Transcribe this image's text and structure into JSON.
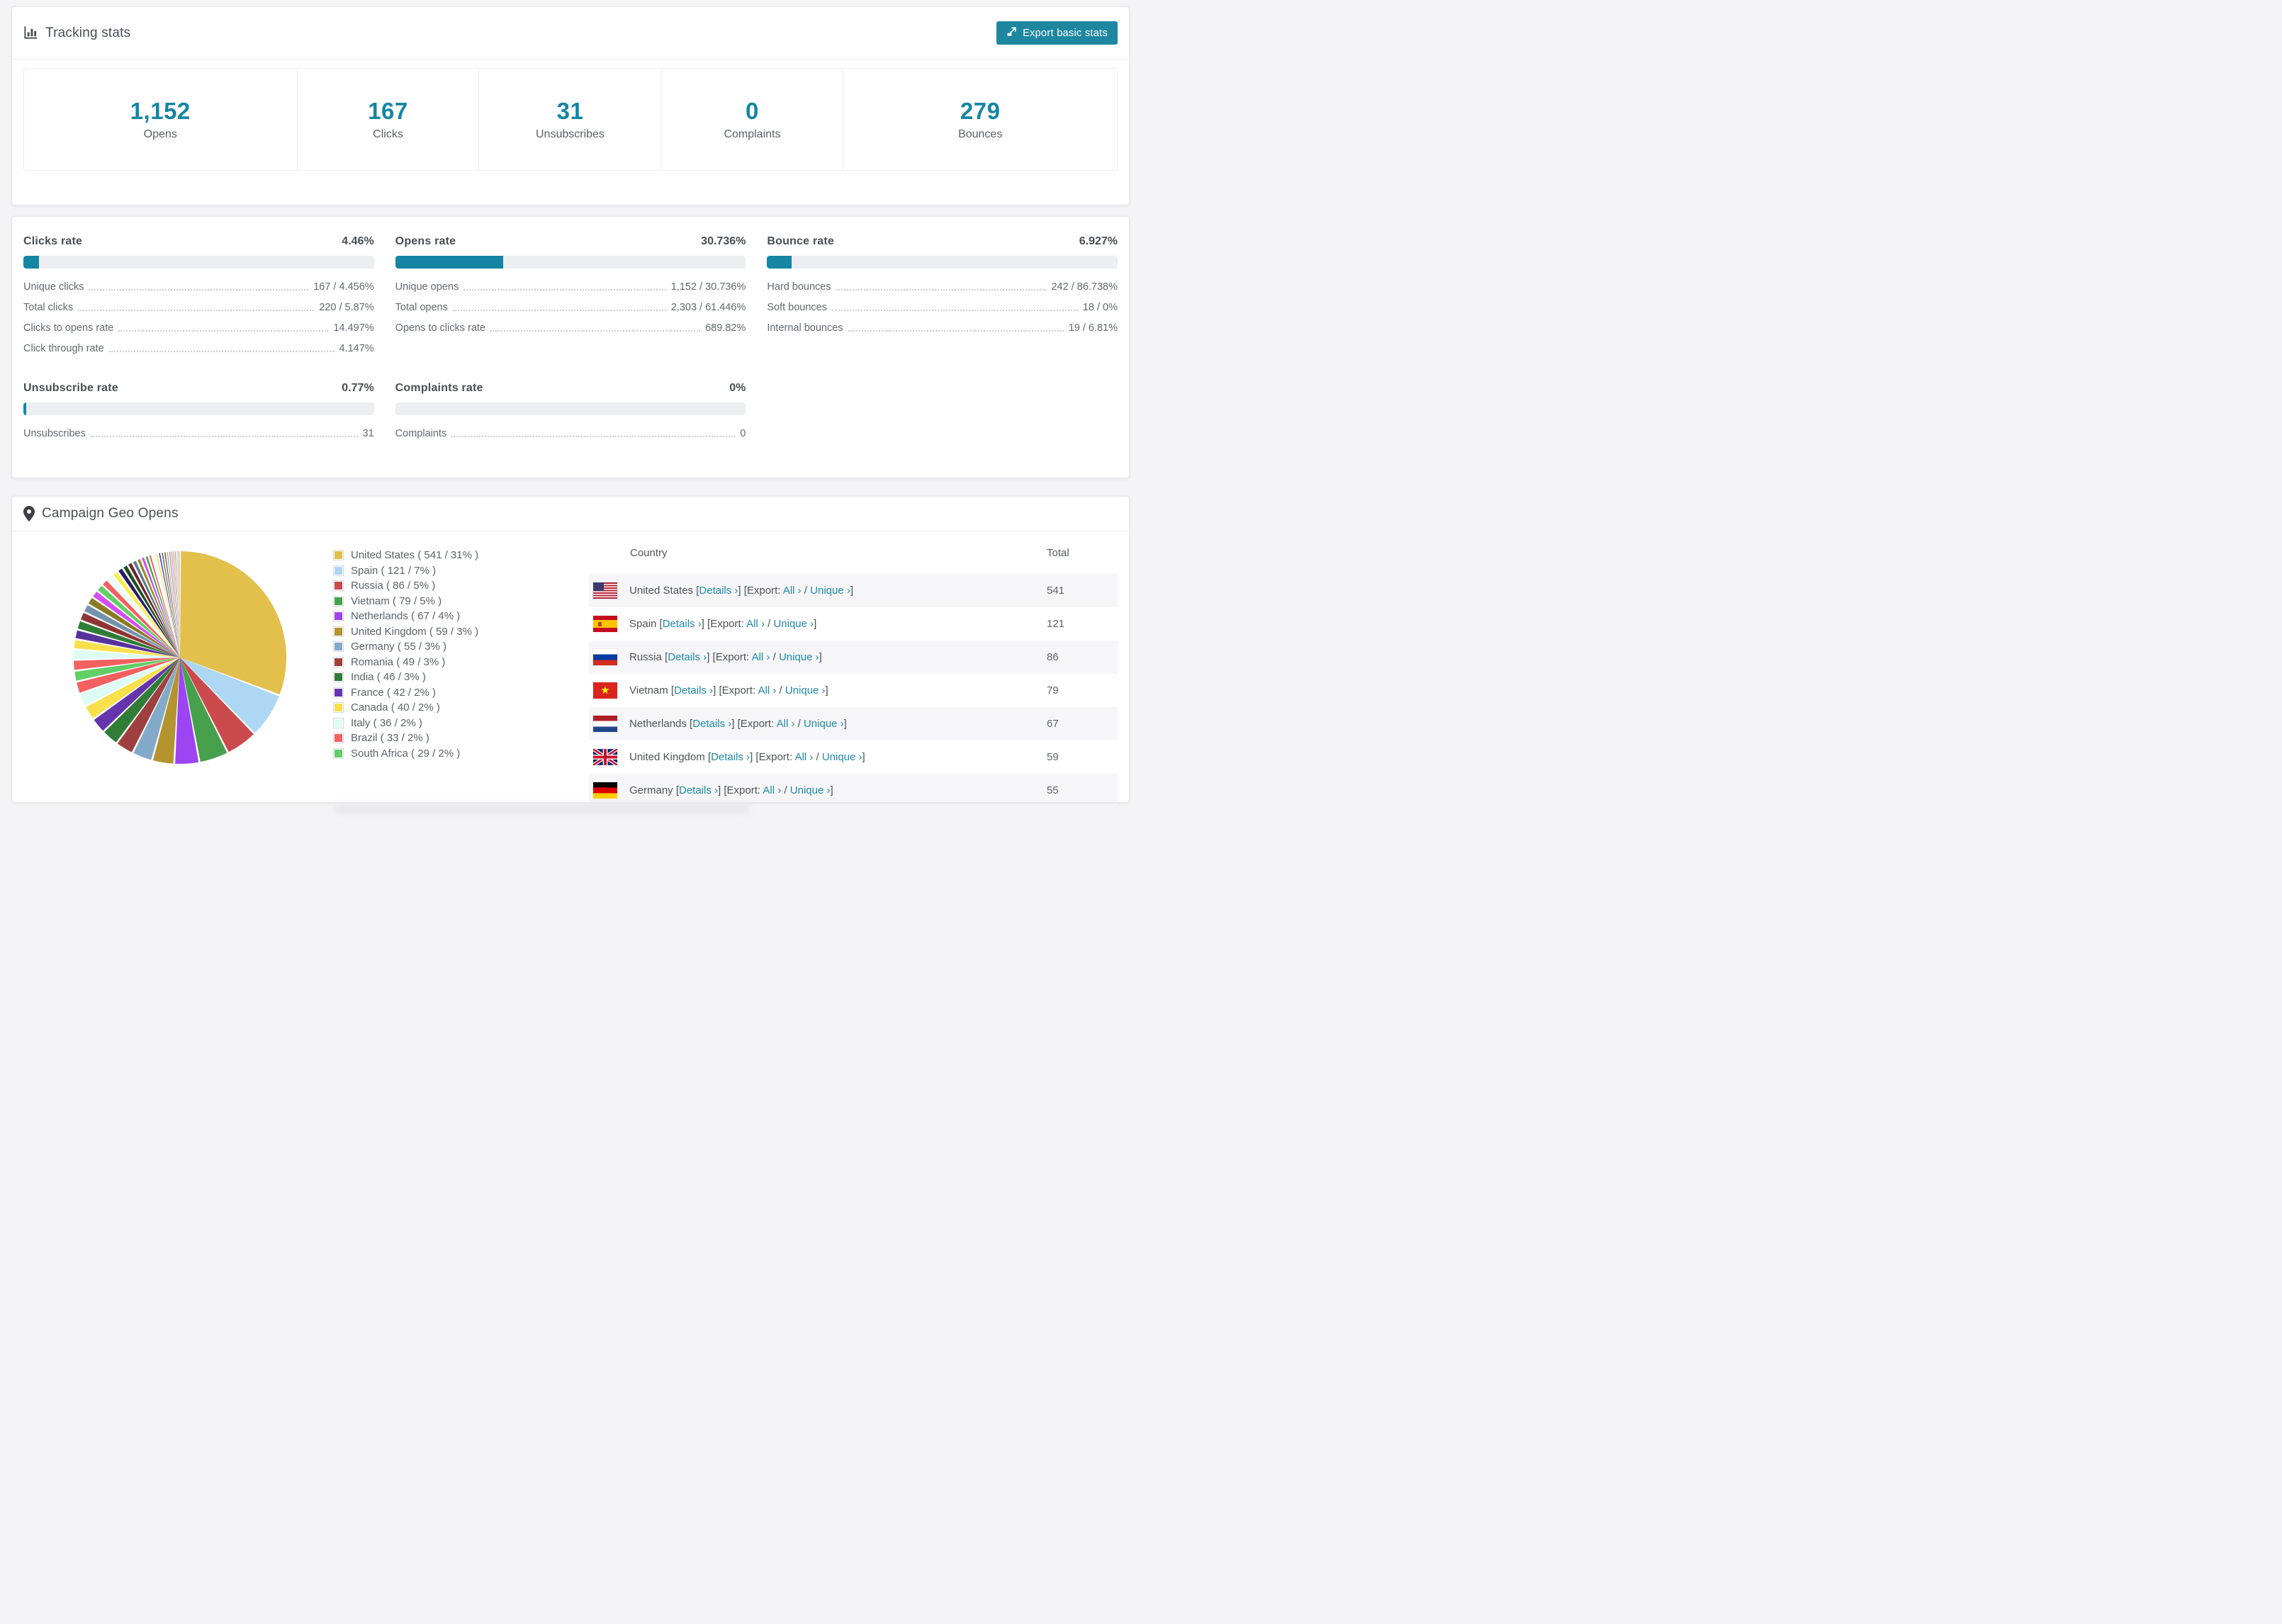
{
  "colors": {
    "accent": "#1585a3",
    "button": "#1d87a0",
    "link": "#1f8aa8",
    "bar_track": "#eceef1",
    "row_stripe": "#f6f6f8"
  },
  "tracking": {
    "title": "Tracking stats",
    "export_button": "Export basic stats",
    "stats": [
      {
        "value": "1,152",
        "label": "Opens"
      },
      {
        "value": "167",
        "label": "Clicks"
      },
      {
        "value": "31",
        "label": "Unsubscribes"
      },
      {
        "value": "0",
        "label": "Complaints"
      },
      {
        "value": "279",
        "label": "Bounces"
      }
    ]
  },
  "rates": [
    {
      "title": "Clicks rate",
      "value": "4.46%",
      "percent": 4.46,
      "rows": [
        {
          "label": "Unique clicks",
          "value": "167 / 4.456%"
        },
        {
          "label": "Total clicks",
          "value": "220 / 5.87%"
        },
        {
          "label": "Clicks to opens rate",
          "value": "14.497%"
        },
        {
          "label": "Click through rate",
          "value": "4.147%"
        }
      ]
    },
    {
      "title": "Opens rate",
      "value": "30.736%",
      "percent": 30.736,
      "rows": [
        {
          "label": "Unique opens",
          "value": "1,152 / 30.736%"
        },
        {
          "label": "Total opens",
          "value": "2,303 / 61.446%"
        },
        {
          "label": "Opens to clicks rate",
          "value": "689.82%"
        }
      ]
    },
    {
      "title": "Bounce rate",
      "value": "6.927%",
      "percent": 6.927,
      "rows": [
        {
          "label": "Hard bounces",
          "value": "242 / 86.738%"
        },
        {
          "label": "Soft bounces",
          "value": "18 / 0%"
        },
        {
          "label": "Internal bounces",
          "value": "19 / 6.81%"
        }
      ]
    },
    {
      "title": "Unsubscribe rate",
      "value": "0.77%",
      "percent": 0.77,
      "rows": [
        {
          "label": "Unsubscribes",
          "value": "31"
        }
      ]
    },
    {
      "title": "Complaints rate",
      "value": "0%",
      "percent": 0,
      "rows": [
        {
          "label": "Complaints",
          "value": "0"
        }
      ]
    }
  ],
  "geo": {
    "title": "Campaign Geo Opens",
    "chart_data": {
      "type": "pie",
      "title": "Campaign Geo Opens",
      "unit": "opens",
      "legend_position": "right",
      "categories": [
        "United States",
        "Spain",
        "Russia",
        "Vietnam",
        "Netherlands",
        "United Kingdom",
        "Germany",
        "Romania",
        "India",
        "France",
        "Canada",
        "Italy",
        "Brazil",
        "South Africa"
      ],
      "values": [
        541,
        121,
        86,
        79,
        67,
        59,
        55,
        49,
        46,
        42,
        40,
        36,
        33,
        29
      ],
      "percents": [
        31,
        7,
        5,
        5,
        4,
        3,
        3,
        3,
        3,
        2,
        2,
        2,
        2,
        2
      ],
      "colors": [
        "#e3bf4b",
        "#aed7f4",
        "#ca4a4e",
        "#47a14c",
        "#9d44f3",
        "#b3942e",
        "#83aac9",
        "#9d4040",
        "#2f7d36",
        "#6634ad",
        "#f8e04d",
        "#dcfcf4",
        "#f4605f",
        "#61ce66"
      ],
      "others": {
        "values": [
          29,
          28,
          27,
          26,
          25,
          24,
          23,
          22,
          21,
          20,
          19,
          18,
          17,
          16,
          15,
          14,
          13,
          12,
          11,
          10,
          9,
          9,
          8,
          8,
          7,
          7,
          6,
          6,
          5,
          5,
          4,
          3,
          2,
          1,
          0.9,
          0.8,
          0.7,
          0.6,
          0.5,
          0.4,
          0.3,
          0.2
        ],
        "colors": [
          "#f4605f",
          "#dcfcf4",
          "#f8e04d",
          "#57319c",
          "#2f7d36",
          "#8f3434",
          "#7492ac",
          "#8a7a22",
          "#d44df0",
          "#61ce66",
          "#f4605f",
          "#eefcfa",
          "#f6ee54",
          "#2b1e5e",
          "#1d4f25",
          "#6e2626",
          "#5b7b94",
          "#9c8a26",
          "#c94ff0",
          "#47a14c",
          "#f25c5c",
          "#dcfcf4",
          "#f8e04d",
          "#6634ad",
          "#2f7d36",
          "#9d4040",
          "#83aac9",
          "#b3942e",
          "#e24fe0",
          "#61ce66",
          "#f4605f",
          "#aed7f4",
          "#d9a62e",
          "#47a14c",
          "#ca4a4e",
          "#aed7f4",
          "#c94ff0",
          "#f8e04d",
          "#2f7d36",
          "#6634ad",
          "#b3942e",
          "#aed7f4"
        ]
      }
    },
    "legend_format": {
      "open": "( ",
      "sep": " / ",
      "close": " )",
      "pct_suffix": "%"
    },
    "table": {
      "columns": [
        "Country",
        "Total"
      ],
      "links": {
        "bracket_open": "[",
        "details": "Details ›",
        "bracket_close": "]",
        "export_prefix": "[Export:",
        "all": "All ›",
        "slash": "/",
        "unique": "Unique ›"
      },
      "rows": [
        {
          "country": "United States",
          "flag": "us",
          "total": "541"
        },
        {
          "country": "Spain",
          "flag": "es",
          "total": "121"
        },
        {
          "country": "Russia",
          "flag": "ru",
          "total": "86"
        },
        {
          "country": "Vietnam",
          "flag": "vn",
          "total": "79"
        },
        {
          "country": "Netherlands",
          "flag": "nl",
          "total": "67"
        },
        {
          "country": "United Kingdom",
          "flag": "gb",
          "total": "59"
        },
        {
          "country": "Germany",
          "flag": "de",
          "total": "55",
          "partial": true
        }
      ]
    }
  }
}
